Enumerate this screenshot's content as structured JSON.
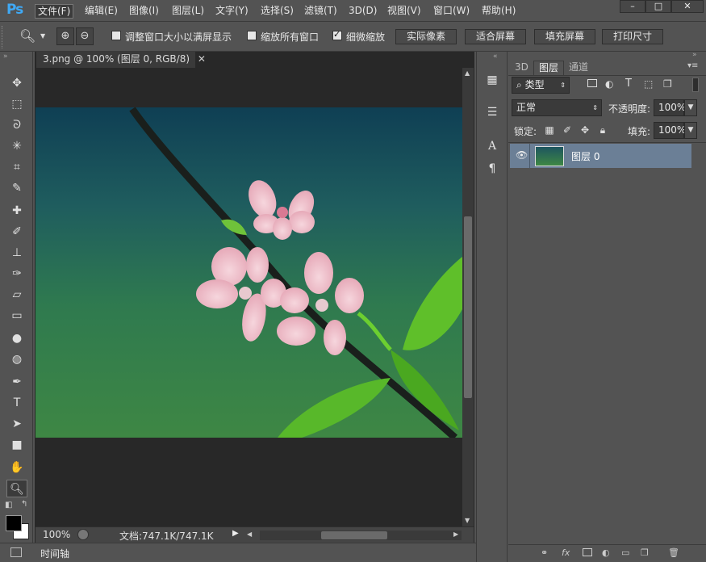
{
  "app": {
    "logo": "Ps"
  },
  "menu": [
    {
      "label": "文件(F)",
      "active": true
    },
    {
      "label": "编辑(E)"
    },
    {
      "label": "图像(I)"
    },
    {
      "label": "图层(L)"
    },
    {
      "label": "文字(Y)"
    },
    {
      "label": "选择(S)"
    },
    {
      "label": "滤镜(T)"
    },
    {
      "label": "3D(D)"
    },
    {
      "label": "视图(V)"
    },
    {
      "label": "窗口(W)"
    },
    {
      "label": "帮助(H)"
    }
  ],
  "options": {
    "resize_windows": {
      "label": "调整窗口大小以满屏显示",
      "checked": false
    },
    "zoom_all": {
      "label": "缩放所有窗口",
      "checked": false
    },
    "scrubby_zoom": {
      "label": "细微缩放",
      "checked": true
    },
    "actual_pixels": "实际像素",
    "fit_screen": "适合屏幕",
    "fill_screen": "填充屏幕",
    "print_size": "打印尺寸"
  },
  "document": {
    "tab_title": "3.png @ 100% (图层 0, RGB/8)",
    "zoom": "100%",
    "doc_info": "文档:747.1K/747.1K"
  },
  "timeline": {
    "label": "时间轴"
  },
  "panels": {
    "tabs": [
      {
        "label": "3D"
      },
      {
        "label": "图层",
        "active": true
      },
      {
        "label": "通道"
      }
    ],
    "filter_kind": "类型",
    "blend_mode": "正常",
    "opacity_label": "不透明度:",
    "opacity_value": "100%",
    "lock_label": "锁定:",
    "fill_label": "填充:",
    "fill_value": "100%",
    "layers": [
      {
        "name": "图层 0",
        "visible": true
      }
    ]
  },
  "colors": {
    "ui_bg": "#535353",
    "canvas_bg": "#282828",
    "selected_layer": "#6b7f96",
    "ps_blue": "#3fa9f5"
  }
}
